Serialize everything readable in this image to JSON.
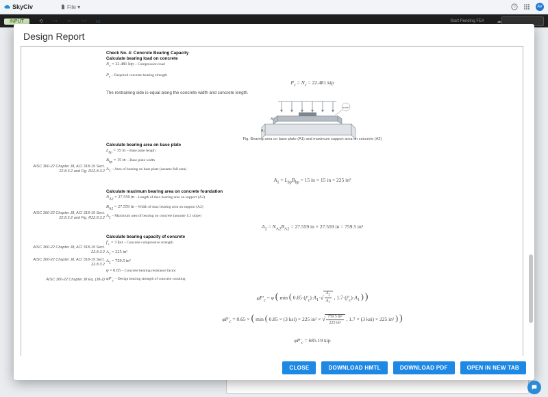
{
  "brand": "SkyCiv",
  "file_menu_label": "File ▾",
  "avatar_initials": "AV",
  "ribbon": {
    "input_chip": "INPUT",
    "start_pending_label": "Start Pending FEA",
    "right_label": ""
  },
  "modal": {
    "title": "Design Report",
    "buttons": {
      "close": "CLOSE",
      "download_html": "DOWNLOAD HMTL",
      "download_pdf": "DOWNLOAD PDF",
      "open_new_tab": "OPEN IN NEW TAB"
    }
  },
  "report": {
    "check4_title": "Check No. 4: Concrete Bearing Capacity",
    "calc_bearing_load_hdr": "Calculate bearing load on concrete",
    "Nc_def": "N₍c₎ = 22.481 kip – Compression load",
    "Pc_def": "P₍c₎ – Required concrete bearing strength",
    "eq_Pc": "P₍c₎ = N₍c₎ = 22.481 kip",
    "restraining_note": "The restraining side is equal along the concrete width and concrete length.",
    "fig_caption": "Fig. Bearing area on base plate (A1) and maximum support area on concrete (A2)",
    "fig_labels": {
      "A1": "A₁",
      "A2": "A₂",
      "node": "node"
    },
    "calc_bearing_area_hdr": "Calculate bearing area on base plate",
    "Lbp_def": "L₍bp₎ = 15 in – Base plate length",
    "Bbp_def": "B₍bp₎ = 15 in – Base plate width",
    "A1_def": "A₁ – Area of bearing on base plate (assume full area)",
    "eq_A1": "A₁ = L₍bp₎·B₍bp₎ = 15 in × 15 in = 225 in²",
    "calc_max_bearing_hdr": "Calculate maximum bearing area on concrete foundation",
    "NA2_def": "N₍A2₎ = 27.559 in – Length of max bearing area on support (A2)",
    "BA2_def": "B₍A2₎ = 27.559 in – Width of max bearing area on support (A2)",
    "A2_def": "A₂ – Maximum area of bearing on concrete (assume 1:2 slope)",
    "eq_A2": "A₂ = N₍A2₎·B₍A2₎ = 27.559 in × 27.559 in = 759.5 in²",
    "calc_capacity_hdr": "Calculate bearing capacity of concrete",
    "fc_def": "f′₍c₎ = 3 ksi – Concrete compressive strength",
    "A1_val": "A₁ = 225 in²",
    "A2_val": "A₂ = 759.5 in²",
    "phi_def": "φ = 0.65 – Concrete bearing resistance factor",
    "phiPc_def": "φP′₍c₎ – Design bearing strength of concrete crushing",
    "eq_phiPc_sym": "φP′₍c₎ = φ ( min ( 0.85·(f′₍c₎)·A₁·√(A₂/A₁) , 1.7·(f′₍c₎)·A₁ ) )",
    "eq_phiPc_num": "φP′₍c₎ = 0.65 × ( min ( 0.85 × (3 ksi) × 225 in² × √(759.5 in² / 225 in²) , 1.7 × (3 ksi) × 225 in² ) )",
    "eq_phiPc_res": "φP′₍c₎ = 685.19 kip",
    "refs": {
      "r1": "AISC 360-22 Chapter J8, ACI 318-19 Sect. 22.8.3.2 and Fig. R22.8.3.2",
      "r2": "AISC 360-22 Chapter J8, ACI 318-19 Sect. 22.8.3.2 and Fig. R22.8.3.2",
      "r3": "AISC 360-22 Chapter J8, ACI 318-19 Sect. 22.8.3.2",
      "r4": "AISC 360-22 Chapter J8, ACI 318-19 Sect. 22.8.3.2",
      "r5": "AISC 360-22 Chapter J8 Eq. (J8-2)"
    }
  },
  "chrome_strip_label": "",
  "chrome_right": ""
}
